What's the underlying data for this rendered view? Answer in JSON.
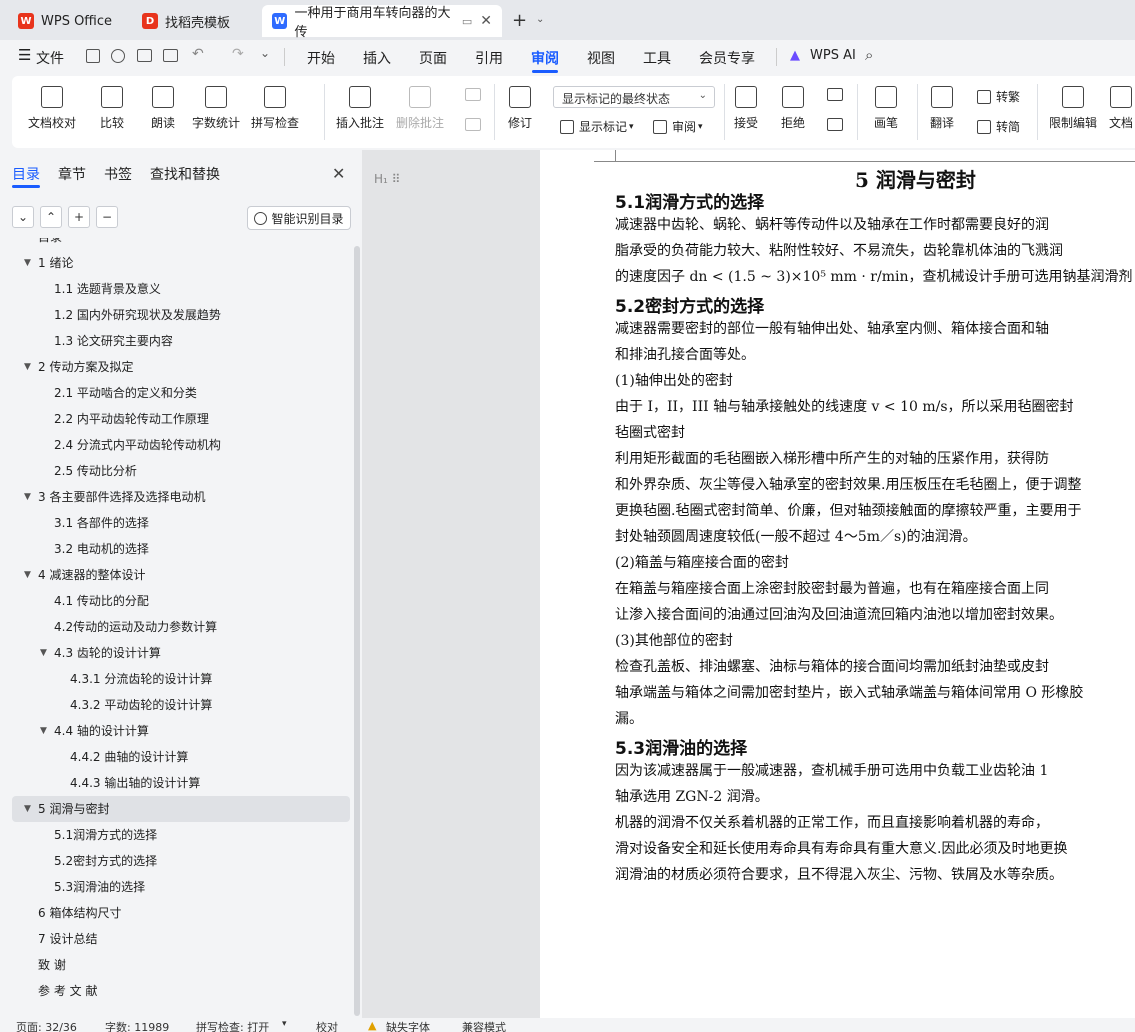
{
  "tabs": [
    {
      "label": "WPS Office",
      "color": "#e8341c",
      "icon": "wps-logo-icon"
    },
    {
      "label": "找稻壳模板",
      "color": "#e8341c",
      "icon": "docer-icon"
    },
    {
      "label": "一种用于商用车转向器的大传",
      "color": "#2f6bff",
      "icon": "word-doc-icon"
    }
  ],
  "menu": {
    "file": "文件",
    "items": [
      "开始",
      "插入",
      "页面",
      "引用",
      "审阅",
      "视图",
      "工具",
      "会员专享"
    ],
    "active": "审阅",
    "ai": "WPS AI"
  },
  "ribbon": {
    "doc_check": "文档校对",
    "compare": "比较",
    "read_aloud": "朗读",
    "word_count": "字数统计",
    "spell_check": "拼写检查",
    "insert_comment": "插入批注",
    "delete_comment": "删除批注",
    "revise": "修订",
    "markup_select": "显示标记的最终状态",
    "show_markup": "显示标记",
    "review": "审阅",
    "accept": "接受",
    "reject": "拒绝",
    "pen": "画笔",
    "translate": "翻译",
    "to_traditional": "转繁",
    "to_simplified": "转简",
    "restrict_edit": "限制编辑",
    "doc_permission": "文档"
  },
  "leftpanel": {
    "tabs": [
      "目录",
      "章节",
      "书签",
      "查找和替换"
    ],
    "smart_toc": "智能识别目录",
    "toc": [
      {
        "text": "目录",
        "level": 1,
        "arrow": ""
      },
      {
        "text": "1  绪论",
        "level": 1,
        "arrow": "▼"
      },
      {
        "text": "1.1  选题背景及意义",
        "level": 2,
        "arrow": ""
      },
      {
        "text": "1.2  国内外研究现状及发展趋势",
        "level": 2,
        "arrow": ""
      },
      {
        "text": "1.3  论文研究主要内容",
        "level": 2,
        "arrow": ""
      },
      {
        "text": "2  传动方案及拟定",
        "level": 1,
        "arrow": "▼"
      },
      {
        "text": "2.1  平动啮合的定义和分类",
        "level": 2,
        "arrow": ""
      },
      {
        "text": "2.2  内平动齿轮传动工作原理",
        "level": 2,
        "arrow": ""
      },
      {
        "text": "2.4  分流式内平动齿轮传动机构",
        "level": 2,
        "arrow": ""
      },
      {
        "text": "2.5  传动比分析",
        "level": 2,
        "arrow": ""
      },
      {
        "text": "3  各主要部件选择及选择电动机",
        "level": 1,
        "arrow": "▼"
      },
      {
        "text": "3.1  各部件的选择",
        "level": 2,
        "arrow": ""
      },
      {
        "text": "3.2  电动机的选择",
        "level": 2,
        "arrow": ""
      },
      {
        "text": "4  减速器的整体设计",
        "level": 1,
        "arrow": "▼"
      },
      {
        "text": "4.1  传动比的分配",
        "level": 2,
        "arrow": ""
      },
      {
        "text": "4.2传动的运动及动力参数计算",
        "level": 2,
        "arrow": ""
      },
      {
        "text": "4.3  齿轮的设计计算",
        "level": 2,
        "arrow": "▼"
      },
      {
        "text": "4.3.1  分流齿轮的设计计算",
        "level": 3,
        "arrow": ""
      },
      {
        "text": "4.3.2  平动齿轮的设计计算",
        "level": 3,
        "arrow": ""
      },
      {
        "text": "4.4  轴的设计计算",
        "level": 2,
        "arrow": "▼"
      },
      {
        "text": "4.4.2  曲轴的设计计算",
        "level": 3,
        "arrow": ""
      },
      {
        "text": "4.4.3  输出轴的设计计算",
        "level": 3,
        "arrow": ""
      },
      {
        "text": "5  润滑与密封",
        "level": 1,
        "arrow": "▼",
        "active": true
      },
      {
        "text": "5.1润滑方式的选择",
        "level": 2,
        "arrow": ""
      },
      {
        "text": "5.2密封方式的选择",
        "level": 2,
        "arrow": ""
      },
      {
        "text": "5.3润滑油的选择",
        "level": 2,
        "arrow": ""
      },
      {
        "text": "6  箱体结构尺寸",
        "level": 1,
        "arrow": ""
      },
      {
        "text": "7  设计总结",
        "level": 1,
        "arrow": ""
      },
      {
        "text": "致    谢",
        "level": 1,
        "arrow": ""
      },
      {
        "text": "参 考 文 献",
        "level": 1,
        "arrow": ""
      }
    ]
  },
  "doc": {
    "chapter": "5  润滑与密封",
    "blocks": [
      {
        "kind": "sec",
        "text": "5.1润滑方式的选择"
      },
      {
        "kind": "ln",
        "text": "        减速器中齿轮、蜗轮、蜗杆等传动件以及轴承在工作时都需要良好的润"
      },
      {
        "kind": "ln",
        "text": "脂承受的负荷能力较大、粘附性较好、不易流失，齿轮靠机体油的飞溅润"
      },
      {
        "kind": "ln",
        "text": "的速度因子 dn < (1.5 ~ 3)×10⁵ mm · r/min，查机械设计手册可选用钠基润滑剂"
      },
      {
        "kind": "sec",
        "text": "5.2密封方式的选择"
      },
      {
        "kind": "ln",
        "text": "        减速器需要密封的部位一般有轴伸出处、轴承室内侧、箱体接合面和轴"
      },
      {
        "kind": "ln",
        "text": "和排油孔接合面等处。"
      },
      {
        "kind": "ln",
        "text": "(1)轴伸出处的密封"
      },
      {
        "kind": "ln",
        "text": "        由于 I，II，III 轴与轴承接触处的线速度 v < 10 m/s，所以采用毡圈密封"
      },
      {
        "kind": "ln",
        "text": "毡圈式密封"
      },
      {
        "kind": "ln",
        "text": "        利用矩形截面的毛毡圈嵌入梯形槽中所产生的对轴的压紧作用，获得防"
      },
      {
        "kind": "ln",
        "text": "和外界杂质、灰尘等侵入轴承室的密封效果.用压板压在毛毡圈上，便于调整"
      },
      {
        "kind": "ln",
        "text": "更换毡圈.毡圈式密封简单、价廉，但对轴颈接触面的摩擦较严重，主要用于"
      },
      {
        "kind": "ln",
        "text": "封处轴颈圆周速度较低(一般不超过 4～5m／s)的油润滑。"
      },
      {
        "kind": "ln",
        "text": "(2)箱盖与箱座接合面的密封"
      },
      {
        "kind": "ln",
        "text": "        在箱盖与箱座接合面上涂密封胶密封最为普遍，也有在箱座接合面上同"
      },
      {
        "kind": "ln",
        "text": "让渗入接合面间的油通过回油沟及回油道流回箱内油池以增加密封效果。"
      },
      {
        "kind": "ln",
        "text": "(3)其他部位的密封"
      },
      {
        "kind": "ln",
        "text": "      检查孔盖板、排油螺塞、油标与箱体的接合面间均需加纸封油垫或皮封"
      },
      {
        "kind": "ln",
        "text": "轴承端盖与箱体之间需加密封垫片，嵌入式轴承端盖与箱体间常用 O 形橡胶"
      },
      {
        "kind": "ln",
        "text": "漏。"
      },
      {
        "kind": "sec",
        "text": "5.3润滑油的选择"
      },
      {
        "kind": "ln",
        "text": "        因为该减速器属于一般减速器，查机械手册可选用中负载工业齿轮油 1"
      },
      {
        "kind": "ln",
        "text": "轴承选用 ZGN-2 润滑。"
      },
      {
        "kind": "ln",
        "text": "        机器的润滑不仅关系着机器的正常工作，而且直接影响着机器的寿命，"
      },
      {
        "kind": "ln",
        "text": "滑对设备安全和延长使用寿命具有寿命具有重大意义.因此必须及时地更换"
      },
      {
        "kind": "ln",
        "text": "润滑油的材质必须符合要求，且不得混入灰尘、污物、铁屑及水等杂质。"
      }
    ]
  },
  "status": {
    "page": "页面: 32/36",
    "words": "字数: 11989",
    "spell": "拼写检查: 打开",
    "proof": "校对",
    "missing_font": "缺失字体",
    "compat": "兼容模式"
  },
  "colors": {
    "accent": "#1a5cff",
    "wps_red": "#e8341c",
    "word_blue": "#2f6bff"
  }
}
